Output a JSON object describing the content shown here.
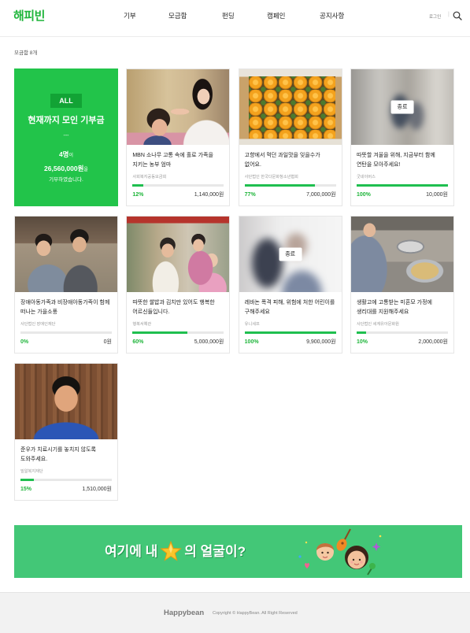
{
  "header": {
    "logo": "해피빈",
    "nav": [
      "기부",
      "모금함",
      "펀딩",
      "캠페인",
      "공지사항"
    ],
    "login": "로그인",
    "divider": "|",
    "search_icon": "search-icon"
  },
  "main": {
    "count_label": "모금함 8개",
    "summary": {
      "badge": "ALL",
      "title": "현재까지 모인 기부금",
      "divider": "---",
      "donors": "4명",
      "donors_suffix": "이",
      "total": "26,560,000원",
      "total_suffix": "을",
      "closing": "기부하였습니다."
    },
    "cards": [
      {
        "title": "MBN 소나무 고통 속에 홀로 가족을 지키는 농부 엄마",
        "organization": "사회복지공동모금회",
        "percent": "12%",
        "progress": 12,
        "amount": "1,140,000원"
      },
      {
        "title": "고향에서 먹던 과일맛을 잊을수가 없어요.",
        "organization": "사단법인 한국다문화청소년협회",
        "percent": "77%",
        "progress": 77,
        "amount": "7,000,000원"
      },
      {
        "title": "따뜻할 겨울을 위해, 지금부터 함께 연탄을 모아주세요!",
        "organization": "굿네이버스",
        "percent": "100%",
        "progress": 100,
        "amount": "10,000원",
        "status": "종료"
      },
      {
        "title": "장애아동가족과 비장애아동가족이 함께 떠나는 가을소풍",
        "organization": "사단법인 장애인재단",
        "percent": "0%",
        "progress": 0,
        "amount": "0원"
      },
      {
        "title": "따뜻한 쌀밥과 김치만 있어도 행복한 어르신들입니다.",
        "organization": "행복서예관",
        "percent": "60%",
        "progress": 60,
        "amount": "5,000,000원"
      },
      {
        "title": "레바논 폭격 피해, 위험에 처한 어린이를 구해주세요",
        "organization": "유니세프",
        "percent": "100%",
        "progress": 100,
        "amount": "9,900,000원",
        "status": "종료"
      },
      {
        "title": "생활고에 고통받는 미혼모 가정에 생리대를 지원해주세요",
        "organization": "사단법인 세계유아문화원",
        "percent": "10%",
        "progress": 10,
        "amount": "2,000,000원"
      },
      {
        "title": "준우가 치료시기를 놓치지 않도록 도와주세요.",
        "organization": "밀알복지재단",
        "percent": "15%",
        "progress": 15,
        "amount": "1,510,000원"
      }
    ]
  },
  "banner": {
    "text_before": "여기에 내",
    "star_icon": "star-icon",
    "text_after": "의 얼굴이?"
  },
  "footer": {
    "logo": "Happybean",
    "copyright": "Copyright © HappyBean. All Right Reserved"
  },
  "colors": {
    "brand_green": "#1eb53a",
    "summary_card_bg": "#22c44a",
    "banner_bg": "#43c777",
    "progress_fill": "#1fbf4f",
    "footer_bg": "#f2f2f2"
  }
}
